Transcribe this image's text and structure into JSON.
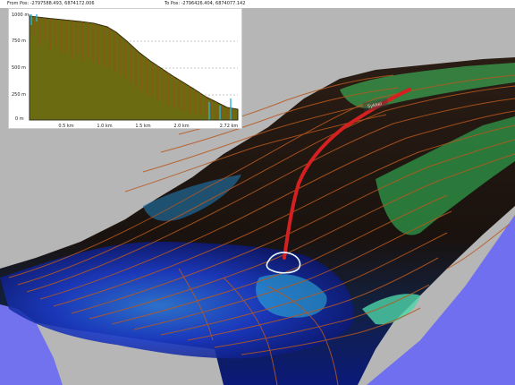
{
  "header": {
    "from_pos": "From Pos: -2797588.493, 6874172.006",
    "to_pos": "To Pos: -2796426.404, 6874077.142"
  },
  "profile_chart": {
    "y_ticks": [
      "1000 m",
      "750 m",
      "500 m",
      "250 m",
      "0 m"
    ],
    "x_ticks": [
      "0.5 km",
      "1.0 km",
      "1.5 km",
      "2.0 km",
      "2.72 km"
    ]
  },
  "scene": {
    "trail_label": "Sykkel"
  },
  "colors": {
    "terrain_dark": "#1a120e",
    "contour": "#b8581e",
    "forest_green": "#2f9a4a",
    "water_blue": "#1f3fd4",
    "sea": "#6f6ff0",
    "route": "#d42020",
    "profile_fill": "#6b6b12"
  }
}
